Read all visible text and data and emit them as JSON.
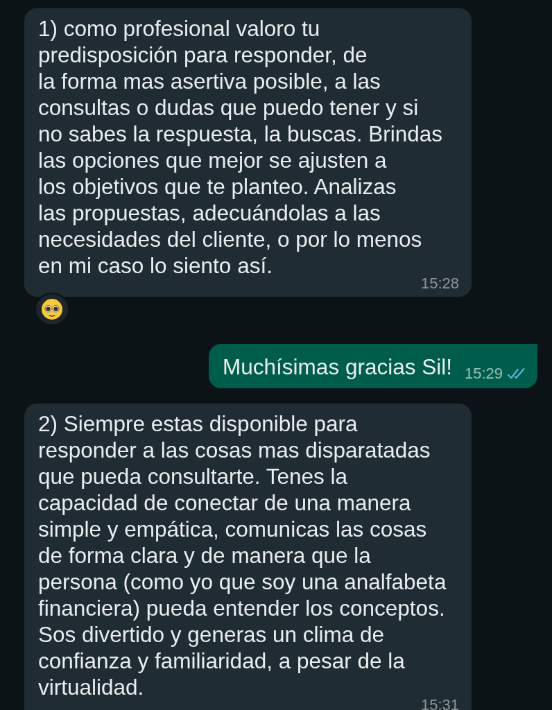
{
  "messages": [
    {
      "kind": "incoming",
      "text": "1) como profesional valoro tu\npredisposición para responder, de\nla forma mas asertiva posible, a las\nconsultas o dudas que puedo tener y si\nno sabes la respuesta, la buscas. Brindas\nlas opciones que mejor se ajusten a\nlos objetivos que te planteo. Analizas\nlas propuestas, adecuándolas a las\nnecesidades del cliente, o por lo menos\nen mi caso lo siento así.",
      "time": "15:28",
      "reacted": true
    },
    {
      "kind": "outgoing",
      "text": "Muchísimas gracias Sil!",
      "time": "15:29",
      "read": true
    },
    {
      "kind": "incoming",
      "text": "2) Siempre estas disponible para\nresponder a las cosas mas disparatadas\nque pueda consultarte. Tenes la\ncapacidad de conectar de una manera\nsimple y empática, comunicas las cosas\nde forma clara y de manera que la\npersona (como yo que soy una analfabeta\nfinanciera) pueda entender los conceptos.\nSos divertido y generas un clima de\nconfianza y familiaridad, a pesar de la\nvirtualidad.",
      "time": "15:31",
      "reacted": false
    }
  ]
}
